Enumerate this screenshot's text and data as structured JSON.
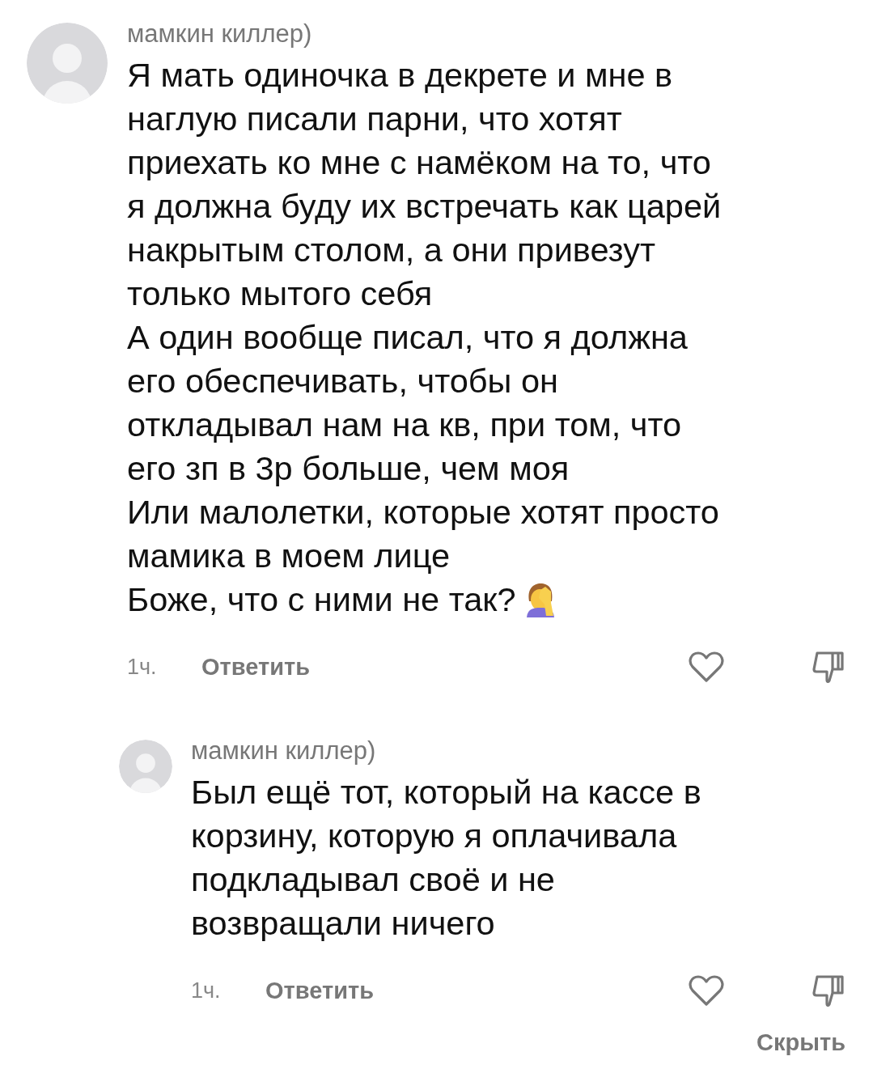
{
  "comments": [
    {
      "author": "мамкин киллер)",
      "paragraphs": [
        "Я мать одиночка в декрете и мне в\nнаглую писали парни, что хотят\nприехать ко мне с намёком на то, что\nя должна буду их встречать как царей\nнакрытым столом, а они привезут\nтолько мытого себя",
        "А один вообще писал, что я должна\nего обеспечивать, чтобы он\nоткладывал нам на кв, при том, что\nего зп в 3р больше, чем моя",
        "Или малолетки, которые хотят просто\nмамика в моем лице",
        "Боже, что с ними не так?"
      ],
      "emoji": true,
      "time": "1ч.",
      "reply": "Ответить",
      "liked": false,
      "kind": "top"
    },
    {
      "author": "мамкин киллер)",
      "paragraphs": [
        "Был ещё тот, который на кассе в\nкорзину, которую я оплачивала\nподкладывал своё и не\nвозвращали ничего"
      ],
      "time": "1ч.",
      "reply": "Ответить",
      "liked": false,
      "kind": "reply"
    }
  ],
  "hide_link": "Скрыть"
}
